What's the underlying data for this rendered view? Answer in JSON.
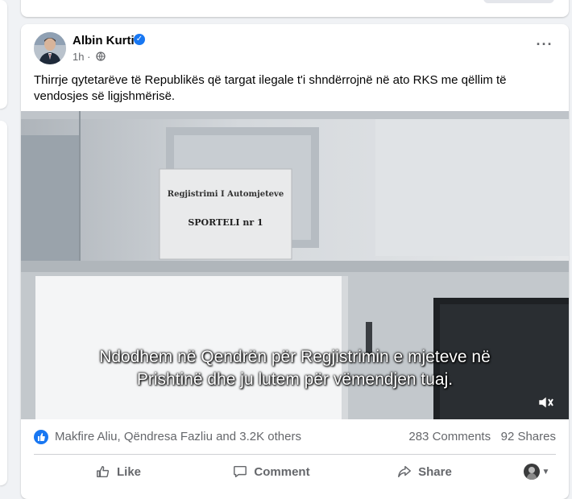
{
  "post": {
    "author": "Albin Kurti",
    "time": "1h",
    "text": "Thirrje qytetarëve të Republikës që targat ilegale t'i shndërrojnë në ato RKS me qëllim të vendosjes së ligjshmërisë.",
    "video": {
      "sign_title": "Regjistrimi I Automjeteve",
      "sign_counter": "SPORTELI nr 1",
      "subtitle_line1": "Ndodhem në Qendrën për Regjistrimin e mjeteve në",
      "subtitle_line2": "Prishtinë dhe ju lutem për vëmendjen tuaj."
    },
    "reactions": {
      "people": "Makfire Aliu, Qëndresa Fazliu and 3.2K others",
      "comments": "283 Comments",
      "shares": "92 Shares"
    },
    "actions": {
      "like": "Like",
      "comment": "Comment",
      "share": "Share"
    }
  },
  "colors": {
    "accent": "#1877f2",
    "secondary_text": "#65676b",
    "background": "#f0f2f5"
  }
}
